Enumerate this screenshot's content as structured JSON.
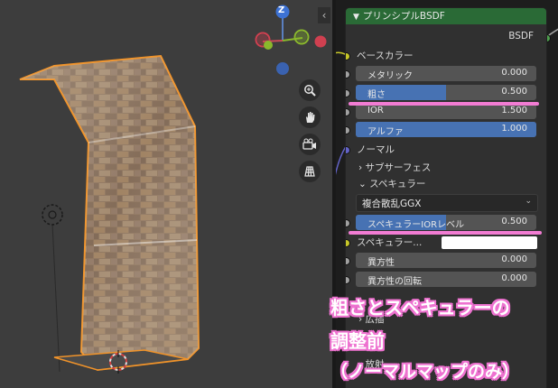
{
  "viewport": {
    "gizmo": {
      "z_label": "Z"
    },
    "nav_icons": [
      "zoom-icon",
      "hand-icon",
      "camera-icon",
      "grid-icon"
    ],
    "collapse_arrow": "‹"
  },
  "node": {
    "title": "プリンシプルBSDF",
    "output_label": "BSDF",
    "base_color_label": "ベースカラー",
    "fields": [
      {
        "label": "メタリック",
        "value": "0.000",
        "fill": 0.0
      },
      {
        "label": "粗さ",
        "value": "0.500",
        "fill": 0.5
      },
      {
        "label": "IOR",
        "value": "1.500",
        "fill": 0.0
      },
      {
        "label": "アルファ",
        "value": "1.000",
        "fill": 1.0
      }
    ],
    "normal_label": "ノーマル",
    "subsurface_label": "サブサーフェス",
    "specular_label": "スペキュラー",
    "distribution": "複合散乱GGX",
    "specular_ior_level": {
      "label": "スペキュラーIORレベル",
      "value": "0.500",
      "fill": 0.5
    },
    "specular_tint_label": "スペキュラー...",
    "anisotropic": {
      "label": "異方性",
      "value": "0.000",
      "fill": 0.0
    },
    "anisotropic_rotation": {
      "label": "異方性の回転",
      "value": "0.000",
      "fill": 0.0
    },
    "lower_expanders": [
      "広插",
      "放射"
    ]
  },
  "annotation": {
    "line1": "粗さとスペキュラーの",
    "line2": "調整前",
    "line3": "（ノーマルマップのみ）",
    "color": "#ee72d0"
  },
  "colors": {
    "socket_yellow": "#c7c729",
    "socket_gray": "#a1a1a1",
    "socket_purple": "#6363c7",
    "header_green": "#2a6a36",
    "field_blue": "#4772b3",
    "selection_orange": "#f0932a"
  }
}
